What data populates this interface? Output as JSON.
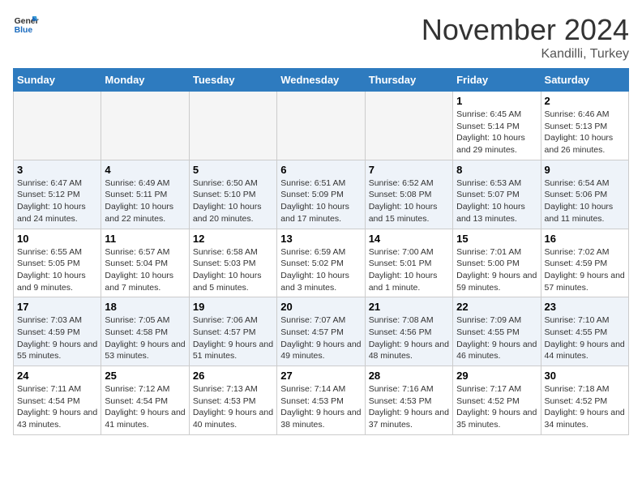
{
  "header": {
    "logo": {
      "general": "General",
      "blue": "Blue"
    },
    "title": "November 2024",
    "location": "Kandilli, Turkey"
  },
  "calendar": {
    "days_of_week": [
      "Sunday",
      "Monday",
      "Tuesday",
      "Wednesday",
      "Thursday",
      "Friday",
      "Saturday"
    ],
    "weeks": [
      [
        {
          "day": null,
          "info": null
        },
        {
          "day": null,
          "info": null
        },
        {
          "day": null,
          "info": null
        },
        {
          "day": null,
          "info": null
        },
        {
          "day": null,
          "info": null
        },
        {
          "day": "1",
          "info": "Sunrise: 6:45 AM\nSunset: 5:14 PM\nDaylight: 10 hours and 29 minutes."
        },
        {
          "day": "2",
          "info": "Sunrise: 6:46 AM\nSunset: 5:13 PM\nDaylight: 10 hours and 26 minutes."
        }
      ],
      [
        {
          "day": "3",
          "info": "Sunrise: 6:47 AM\nSunset: 5:12 PM\nDaylight: 10 hours and 24 minutes."
        },
        {
          "day": "4",
          "info": "Sunrise: 6:49 AM\nSunset: 5:11 PM\nDaylight: 10 hours and 22 minutes."
        },
        {
          "day": "5",
          "info": "Sunrise: 6:50 AM\nSunset: 5:10 PM\nDaylight: 10 hours and 20 minutes."
        },
        {
          "day": "6",
          "info": "Sunrise: 6:51 AM\nSunset: 5:09 PM\nDaylight: 10 hours and 17 minutes."
        },
        {
          "day": "7",
          "info": "Sunrise: 6:52 AM\nSunset: 5:08 PM\nDaylight: 10 hours and 15 minutes."
        },
        {
          "day": "8",
          "info": "Sunrise: 6:53 AM\nSunset: 5:07 PM\nDaylight: 10 hours and 13 minutes."
        },
        {
          "day": "9",
          "info": "Sunrise: 6:54 AM\nSunset: 5:06 PM\nDaylight: 10 hours and 11 minutes."
        }
      ],
      [
        {
          "day": "10",
          "info": "Sunrise: 6:55 AM\nSunset: 5:05 PM\nDaylight: 10 hours and 9 minutes."
        },
        {
          "day": "11",
          "info": "Sunrise: 6:57 AM\nSunset: 5:04 PM\nDaylight: 10 hours and 7 minutes."
        },
        {
          "day": "12",
          "info": "Sunrise: 6:58 AM\nSunset: 5:03 PM\nDaylight: 10 hours and 5 minutes."
        },
        {
          "day": "13",
          "info": "Sunrise: 6:59 AM\nSunset: 5:02 PM\nDaylight: 10 hours and 3 minutes."
        },
        {
          "day": "14",
          "info": "Sunrise: 7:00 AM\nSunset: 5:01 PM\nDaylight: 10 hours and 1 minute."
        },
        {
          "day": "15",
          "info": "Sunrise: 7:01 AM\nSunset: 5:00 PM\nDaylight: 9 hours and 59 minutes."
        },
        {
          "day": "16",
          "info": "Sunrise: 7:02 AM\nSunset: 4:59 PM\nDaylight: 9 hours and 57 minutes."
        }
      ],
      [
        {
          "day": "17",
          "info": "Sunrise: 7:03 AM\nSunset: 4:59 PM\nDaylight: 9 hours and 55 minutes."
        },
        {
          "day": "18",
          "info": "Sunrise: 7:05 AM\nSunset: 4:58 PM\nDaylight: 9 hours and 53 minutes."
        },
        {
          "day": "19",
          "info": "Sunrise: 7:06 AM\nSunset: 4:57 PM\nDaylight: 9 hours and 51 minutes."
        },
        {
          "day": "20",
          "info": "Sunrise: 7:07 AM\nSunset: 4:57 PM\nDaylight: 9 hours and 49 minutes."
        },
        {
          "day": "21",
          "info": "Sunrise: 7:08 AM\nSunset: 4:56 PM\nDaylight: 9 hours and 48 minutes."
        },
        {
          "day": "22",
          "info": "Sunrise: 7:09 AM\nSunset: 4:55 PM\nDaylight: 9 hours and 46 minutes."
        },
        {
          "day": "23",
          "info": "Sunrise: 7:10 AM\nSunset: 4:55 PM\nDaylight: 9 hours and 44 minutes."
        }
      ],
      [
        {
          "day": "24",
          "info": "Sunrise: 7:11 AM\nSunset: 4:54 PM\nDaylight: 9 hours and 43 minutes."
        },
        {
          "day": "25",
          "info": "Sunrise: 7:12 AM\nSunset: 4:54 PM\nDaylight: 9 hours and 41 minutes."
        },
        {
          "day": "26",
          "info": "Sunrise: 7:13 AM\nSunset: 4:53 PM\nDaylight: 9 hours and 40 minutes."
        },
        {
          "day": "27",
          "info": "Sunrise: 7:14 AM\nSunset: 4:53 PM\nDaylight: 9 hours and 38 minutes."
        },
        {
          "day": "28",
          "info": "Sunrise: 7:16 AM\nSunset: 4:53 PM\nDaylight: 9 hours and 37 minutes."
        },
        {
          "day": "29",
          "info": "Sunrise: 7:17 AM\nSunset: 4:52 PM\nDaylight: 9 hours and 35 minutes."
        },
        {
          "day": "30",
          "info": "Sunrise: 7:18 AM\nSunset: 4:52 PM\nDaylight: 9 hours and 34 minutes."
        }
      ]
    ]
  }
}
